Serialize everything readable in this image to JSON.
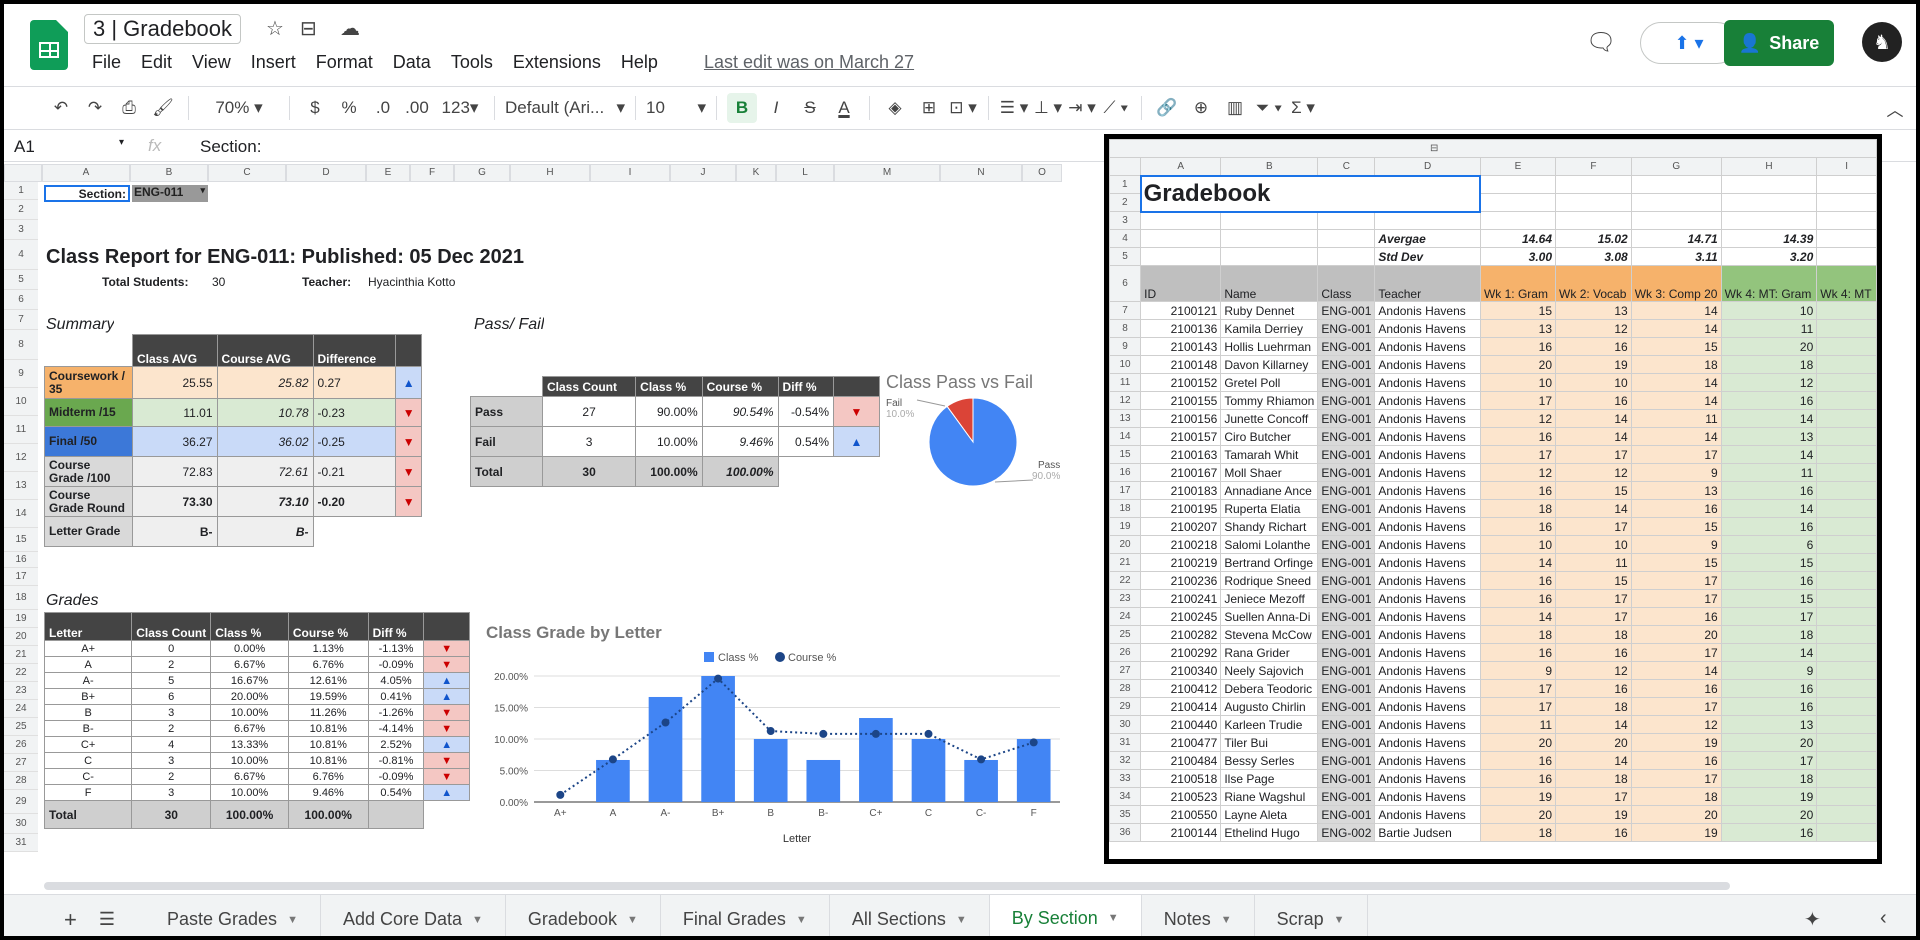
{
  "doc": {
    "title": "3 | Gradebook",
    "last_edit": "Last edit was on March 27"
  },
  "menu": [
    "File",
    "Edit",
    "View",
    "Insert",
    "Format",
    "Data",
    "Tools",
    "Extensions",
    "Help"
  ],
  "share_label": "Share",
  "toolbar": {
    "zoom": "70%",
    "currency": "$",
    "percent": "%",
    "dec_less": ".0",
    "dec_more": ".00",
    "format": "123",
    "font": "Default (Ari...",
    "size": "10",
    "bold": "B",
    "italic": "I",
    "strike": "S",
    "textcolor": "A"
  },
  "formula": {
    "cellref": "A1",
    "fx": "fx",
    "content": "Section:"
  },
  "columns_left": [
    "A",
    "B",
    "C",
    "D",
    "E",
    "F",
    "G",
    "H",
    "I",
    "J",
    "K",
    "L",
    "M",
    "N",
    "O"
  ],
  "report": {
    "section_label": "Section:",
    "section_value": "ENG-011",
    "title": "Class Report for ENG-011: Published: 05 Dec 2021",
    "total_students_label": "Total Students:",
    "total_students": "30",
    "teacher_label": "Teacher:",
    "teacher": "Hyacinthia Kotto",
    "summary_label": "Summary",
    "passfail_label": "Pass/ Fail",
    "grades_label": "Grades"
  },
  "summary": {
    "headers": [
      "Class AVG",
      "Course AVG",
      "Difference"
    ],
    "rows": [
      {
        "label": "Coursework / 35",
        "cls": "25.55",
        "course": "25.82",
        "diff": "0.27",
        "dir": "up",
        "color": "#f6b26b",
        "light": "#fce5cd"
      },
      {
        "label": "Midterm /15",
        "cls": "11.01",
        "course": "10.78",
        "diff": "-0.23",
        "dir": "down",
        "color": "#6aa84f",
        "light": "#d9ead3"
      },
      {
        "label": "Final /50",
        "cls": "36.27",
        "course": "36.02",
        "diff": "-0.25",
        "dir": "down",
        "color": "#3c78d8",
        "light": "#c9daf8"
      },
      {
        "label": "Course Grade /100",
        "cls": "72.83",
        "course": "72.61",
        "diff": "-0.21",
        "dir": "down",
        "color": "#d9d9d9",
        "light": "#efefef"
      },
      {
        "label": "Course Grade Round",
        "cls": "73.30",
        "course": "73.10",
        "diff": "-0.20",
        "dir": "down",
        "color": "#d9d9d9",
        "light": "#efefef"
      },
      {
        "label": "Letter Grade",
        "cls": "B-",
        "course": "B-",
        "diff": "",
        "dir": "",
        "color": "#d9d9d9",
        "light": "#efefef"
      }
    ]
  },
  "passfail": {
    "headers": [
      "Class Count",
      "Class %",
      "Course %",
      "Diff %"
    ],
    "rows": [
      {
        "label": "Pass",
        "count": "27",
        "cls": "90.00%",
        "course": "90.54%",
        "diff": "-0.54%",
        "dir": "down"
      },
      {
        "label": "Fail",
        "count": "3",
        "cls": "10.00%",
        "course": "9.46%",
        "diff": "0.54%",
        "dir": "up"
      },
      {
        "label": "Total",
        "count": "30",
        "cls": "100.00%",
        "course": "100.00%",
        "diff": "",
        "dir": ""
      }
    ]
  },
  "grades": {
    "headers": [
      "Letter",
      "Class Count",
      "Class %",
      "Course %",
      "Diff %"
    ],
    "rows": [
      [
        "A+",
        "0",
        "0.00%",
        "1.13%",
        "-1.13%",
        "down"
      ],
      [
        "A",
        "2",
        "6.67%",
        "6.76%",
        "-0.09%",
        "down"
      ],
      [
        "A-",
        "5",
        "16.67%",
        "12.61%",
        "4.05%",
        "up"
      ],
      [
        "B+",
        "6",
        "20.00%",
        "19.59%",
        "0.41%",
        "up"
      ],
      [
        "B",
        "3",
        "10.00%",
        "11.26%",
        "-1.26%",
        "down"
      ],
      [
        "B-",
        "2",
        "6.67%",
        "10.81%",
        "-4.14%",
        "down"
      ],
      [
        "C+",
        "4",
        "13.33%",
        "10.81%",
        "2.52%",
        "up"
      ],
      [
        "C",
        "3",
        "10.00%",
        "10.81%",
        "-0.81%",
        "down"
      ],
      [
        "C-",
        "2",
        "6.67%",
        "6.76%",
        "-0.09%",
        "down"
      ],
      [
        "F",
        "3",
        "10.00%",
        "9.46%",
        "0.54%",
        "up"
      ]
    ],
    "total": [
      "Total",
      "30",
      "100.00%",
      "100.00%"
    ]
  },
  "chart_data": [
    {
      "type": "pie",
      "title": "Class Pass vs Fail",
      "categories": [
        "Pass",
        "Fail"
      ],
      "values": [
        90.0,
        10.0
      ],
      "labels": [
        "Pass",
        "Fail"
      ],
      "pct_labels": [
        "90.0%",
        "10.0%"
      ],
      "colors": [
        "#4285f4",
        "#db4437"
      ]
    },
    {
      "type": "bar",
      "title": "Class Grade by Letter",
      "xlabel": "Letter",
      "categories": [
        "A+",
        "A",
        "A-",
        "B+",
        "B",
        "B-",
        "C+",
        "C",
        "C-",
        "F"
      ],
      "series": [
        {
          "name": "Class %",
          "type": "bar",
          "color": "#4285f4",
          "values": [
            0.0,
            6.67,
            16.67,
            20.0,
            10.0,
            6.67,
            13.33,
            10.0,
            6.67,
            10.0
          ]
        },
        {
          "name": "Course %",
          "type": "line",
          "color": "#1c4587",
          "values": [
            1.13,
            6.76,
            12.61,
            19.59,
            11.26,
            10.81,
            10.81,
            10.81,
            6.76,
            9.46
          ]
        }
      ],
      "ylim": [
        0,
        20
      ],
      "yticks": [
        "0.00%",
        "5.00%",
        "10.00%",
        "15.00%",
        "20.00%"
      ]
    }
  ],
  "panel": {
    "title": "Gradebook",
    "col_letters": [
      "A",
      "B",
      "C",
      "D",
      "E",
      "F",
      "G",
      "H",
      "I"
    ],
    "avg_label": "Avergae",
    "std_label": "Std Dev",
    "avg": [
      "14.64",
      "15.02",
      "14.71",
      "14.39"
    ],
    "std": [
      "3.00",
      "3.08",
      "3.11",
      "3.20"
    ],
    "headers": [
      "ID",
      "Name",
      "Class",
      "Teacher",
      "Wk 1: Gram",
      "Wk 2: Vocab",
      "Wk 3: Comp 20",
      "Wk 4: MT: Gram",
      "Wk 4: MT"
    ],
    "rows": [
      [
        "7",
        "2100121",
        "Ruby Dennet",
        "ENG-001",
        "Andonis Havens",
        "15",
        "13",
        "14",
        "10"
      ],
      [
        "8",
        "2100136",
        "Kamila Derriey",
        "ENG-001",
        "Andonis Havens",
        "13",
        "12",
        "14",
        "11"
      ],
      [
        "9",
        "2100143",
        "Hollis Luehrman",
        "ENG-001",
        "Andonis Havens",
        "16",
        "16",
        "15",
        "20"
      ],
      [
        "10",
        "2100148",
        "Davon Killarney",
        "ENG-001",
        "Andonis Havens",
        "20",
        "19",
        "18",
        "18"
      ],
      [
        "11",
        "2100152",
        "Gretel Poll",
        "ENG-001",
        "Andonis Havens",
        "10",
        "10",
        "14",
        "12"
      ],
      [
        "12",
        "2100155",
        "Tommy Rhiamon",
        "ENG-001",
        "Andonis Havens",
        "17",
        "16",
        "14",
        "16"
      ],
      [
        "13",
        "2100156",
        "Junette Concoff",
        "ENG-001",
        "Andonis Havens",
        "12",
        "14",
        "11",
        "14"
      ],
      [
        "14",
        "2100157",
        "Ciro Butcher",
        "ENG-001",
        "Andonis Havens",
        "16",
        "14",
        "14",
        "13"
      ],
      [
        "15",
        "2100163",
        "Tamarah Whit",
        "ENG-001",
        "Andonis Havens",
        "17",
        "17",
        "17",
        "14"
      ],
      [
        "16",
        "2100167",
        "Moll Shaer",
        "ENG-001",
        "Andonis Havens",
        "12",
        "12",
        "9",
        "11"
      ],
      [
        "17",
        "2100183",
        "Annadiane Ance",
        "ENG-001",
        "Andonis Havens",
        "16",
        "15",
        "13",
        "16"
      ],
      [
        "18",
        "2100195",
        "Ruperta Elatia",
        "ENG-001",
        "Andonis Havens",
        "18",
        "14",
        "16",
        "14"
      ],
      [
        "19",
        "2100207",
        "Shandy Richart",
        "ENG-001",
        "Andonis Havens",
        "16",
        "17",
        "15",
        "16"
      ],
      [
        "20",
        "2100218",
        "Salomi Lolanthe",
        "ENG-001",
        "Andonis Havens",
        "10",
        "10",
        "9",
        "6"
      ],
      [
        "21",
        "2100219",
        "Bertrand Orfinge",
        "ENG-001",
        "Andonis Havens",
        "14",
        "11",
        "15",
        "15"
      ],
      [
        "22",
        "2100236",
        "Rodrique Sneed",
        "ENG-001",
        "Andonis Havens",
        "16",
        "15",
        "17",
        "16"
      ],
      [
        "23",
        "2100241",
        "Jeniece Mezoff",
        "ENG-001",
        "Andonis Havens",
        "16",
        "17",
        "17",
        "15"
      ],
      [
        "24",
        "2100245",
        "Suellen Anna-Di",
        "ENG-001",
        "Andonis Havens",
        "14",
        "17",
        "16",
        "17"
      ],
      [
        "25",
        "2100282",
        "Stevena McCow",
        "ENG-001",
        "Andonis Havens",
        "18",
        "18",
        "20",
        "18"
      ],
      [
        "26",
        "2100292",
        "Rana Grider",
        "ENG-001",
        "Andonis Havens",
        "16",
        "16",
        "17",
        "14"
      ],
      [
        "27",
        "2100340",
        "Neely Sajovich",
        "ENG-001",
        "Andonis Havens",
        "9",
        "12",
        "14",
        "9"
      ],
      [
        "28",
        "2100412",
        "Debera Teodoric",
        "ENG-001",
        "Andonis Havens",
        "17",
        "16",
        "16",
        "16"
      ],
      [
        "29",
        "2100414",
        "Augusto Chirlin",
        "ENG-001",
        "Andonis Havens",
        "17",
        "18",
        "17",
        "16"
      ],
      [
        "30",
        "2100440",
        "Karleen Trudie",
        "ENG-001",
        "Andonis Havens",
        "11",
        "14",
        "12",
        "13"
      ],
      [
        "31",
        "2100477",
        "Tiler Bui",
        "ENG-001",
        "Andonis Havens",
        "20",
        "20",
        "19",
        "20"
      ],
      [
        "32",
        "2100484",
        "Bessy Serles",
        "ENG-001",
        "Andonis Havens",
        "16",
        "14",
        "16",
        "17"
      ],
      [
        "33",
        "2100518",
        "Ilse Page",
        "ENG-001",
        "Andonis Havens",
        "16",
        "18",
        "17",
        "18"
      ],
      [
        "34",
        "2100523",
        "Riane Wagshul",
        "ENG-001",
        "Andonis Havens",
        "19",
        "17",
        "18",
        "19"
      ],
      [
        "35",
        "2100550",
        "Layne Aleta",
        "ENG-001",
        "Andonis Havens",
        "20",
        "19",
        "20",
        "20"
      ],
      [
        "36",
        "2100144",
        "Ethelind Hugo",
        "ENG-002",
        "Bartie Judsen",
        "18",
        "16",
        "19",
        "16"
      ]
    ]
  },
  "tabs": [
    "Paste Grades",
    "Add Core Data",
    "Gradebook",
    "Final Grades",
    "All Sections",
    "By Section",
    "Notes",
    "Scrap"
  ],
  "active_tab": "By Section",
  "colors": {
    "brand_green": "#188038",
    "blue": "#4285f4",
    "orange": "#f6b26b",
    "green": "#93c47d"
  }
}
